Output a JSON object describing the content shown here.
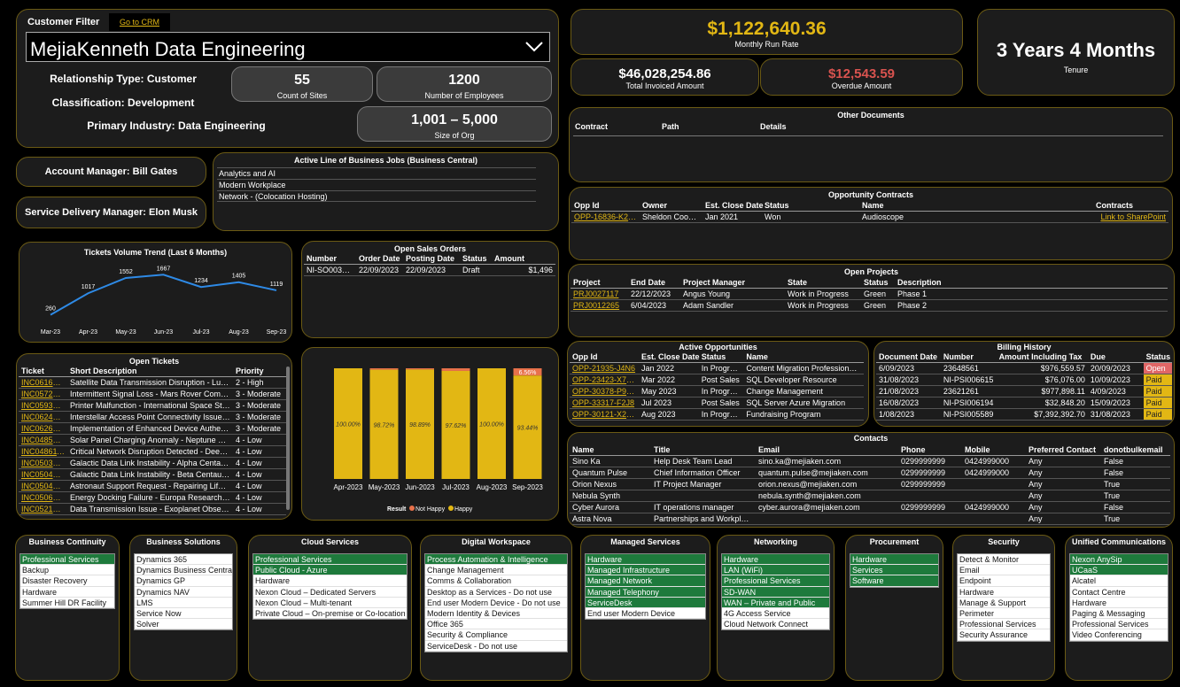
{
  "filter": {
    "label": "Customer Filter",
    "crm_link": "Go to CRM",
    "selected": "MejiaKenneth Data Engineering"
  },
  "customer": {
    "relationship": "Relationship Type: Customer",
    "classification": "Classification: Development",
    "industry": "Primary Industry: Data Engineering",
    "sites": {
      "value": "55",
      "caption": "Count of Sites"
    },
    "employees": {
      "value": "1200",
      "caption": "Number of Employees"
    },
    "org": {
      "value": "1,001 – 5,000",
      "caption": "Size of Org"
    }
  },
  "kpi": {
    "run_rate": {
      "value": "$1,122,640.36",
      "caption": "Monthly Run Rate"
    },
    "invoiced": {
      "value": "$46,028,254.86",
      "caption": "Total Invoiced Amount"
    },
    "overdue": {
      "value": "$12,543.59",
      "caption": "Overdue Amount"
    },
    "tenure": {
      "value": "3 Years 4 Months",
      "caption": "Tenure"
    }
  },
  "colors": {
    "gold": "#e2b714",
    "red": "#d9534f",
    "green": "#1e7a3c",
    "line": "#2e8ae6",
    "not_happy": "#e8714a"
  },
  "managers": {
    "account": "Account Manager: Bill Gates",
    "service": "Service Delivery Manager: Elon Musk"
  },
  "lob": {
    "title": "Active Line of Business Jobs (Business Central)",
    "items": [
      "Analytics and AI",
      "Modern Workplace",
      "Network - (Colocation Hosting)"
    ]
  },
  "docs": {
    "title": "Other Documents",
    "headers": [
      "Contract",
      "Path",
      "Details"
    ]
  },
  "opp_contracts": {
    "title": "Opportunity Contracts",
    "headers": [
      "Opp Id",
      "Owner",
      "Est. Close Date",
      "Status",
      "Name",
      "Contracts"
    ],
    "rows": [
      [
        "OPP-16836-K2X5",
        "Sheldon Cooper",
        "Jan 2021",
        "Won",
        "Audioscope",
        "Link to SharePoint"
      ]
    ]
  },
  "tickets_trend": {
    "title": "Tickets Volume Trend (Last 6 Months)"
  },
  "chart_data": [
    {
      "type": "line",
      "title": "Tickets Volume Trend (Last 6 Months)",
      "categories": [
        "Mar-23",
        "Apr-23",
        "May-23",
        "Jun-23",
        "Jul-23",
        "Aug-23",
        "Sep-23"
      ],
      "values": [
        260,
        1017,
        1552,
        1667,
        1234,
        1405,
        1119
      ],
      "labels": [
        "260",
        "1017",
        "1552",
        "1667",
        "1234",
        "1405",
        "1119"
      ]
    },
    {
      "type": "bar",
      "stacked": true,
      "categories": [
        "Apr-2023",
        "May-2023",
        "Jun-2023",
        "Jul-2023",
        "Aug-2023",
        "Sep-2023"
      ],
      "series": [
        {
          "name": "Happy",
          "values": [
            100.0,
            98.72,
            98.89,
            97.62,
            100.0,
            93.44
          ]
        },
        {
          "name": "Not Happy",
          "values": [
            0,
            1.28,
            1.11,
            2.38,
            0,
            6.56
          ]
        }
      ],
      "happy_labels": [
        "100.00%",
        "98.72%",
        "98.89%",
        "97.62%",
        "100.00%",
        "93.44%"
      ],
      "not_happy_label": "6.56%",
      "legend_title": "Result",
      "legend": [
        "Not Happy",
        "Happy"
      ]
    }
  ],
  "sales_orders": {
    "title": "Open Sales Orders",
    "headers": [
      "Number",
      "Order Date",
      "Posting Date",
      "Status",
      "Amount"
    ],
    "rows": [
      [
        "NI-SO003184",
        "22/09/2023",
        "22/09/2023",
        "Draft",
        "$1,496"
      ]
    ]
  },
  "projects": {
    "title": "Open Projects",
    "headers": [
      "Project",
      "End Date",
      "Project Manager",
      "State",
      "Status",
      "Description"
    ],
    "rows": [
      [
        "PRJ0027117",
        "22/12/2023",
        "Angus Young",
        "Work in Progress",
        "Green",
        "Phase 1"
      ],
      [
        "PRJ0012265",
        "6/04/2023",
        "Adam Sandler",
        "Work in Progress",
        "Green",
        "Phase 2"
      ]
    ]
  },
  "tickets": {
    "title": "Open Tickets",
    "headers": [
      "Ticket",
      "Short Description",
      "Priority"
    ],
    "rows": [
      [
        "INC0616232",
        "Satellite Data Transmission Disruption - Luna...",
        "2 - High"
      ],
      [
        "INC0572587",
        "Intermittent Signal Loss - Mars Rover Comm...",
        "3 - Moderate"
      ],
      [
        "INC0593758",
        "Printer Malfunction - International Space Sta...",
        "3 - Moderate"
      ],
      [
        "INC0624386",
        "Interstellar Access Point Connectivity Issue - ...",
        "3 - Moderate"
      ],
      [
        "INC0626735",
        "Implementation of Enhanced Device Authen...",
        "3 - Moderate"
      ],
      [
        "INC0485341",
        "Solar Panel Charging Anomaly - Neptune Re...",
        "4 - Low"
      ],
      [
        "INC0486118",
        "Critical Network Disruption Detected - Deep ...",
        "4 - Low"
      ],
      [
        "INC0503784",
        "Galactic Data Link Instability - Alpha Centaur...",
        "4 - Low"
      ],
      [
        "INC0504832",
        "Galactic Data Link Instability - Beta Centauri ...",
        "4 - Low"
      ],
      [
        "INC0504833",
        "Astronaut Support Request - Repairing Life S...",
        "4 - Low"
      ],
      [
        "INC0506844",
        "Energy Docking Failure - Europa Research Fa...",
        "4 - Low"
      ],
      [
        "INC0521245",
        "Data Transmission Issue - Exoplanet Observa...",
        "4 - Low"
      ]
    ]
  },
  "active_opps": {
    "title": "Active Opportunities",
    "headers": [
      "Opp Id",
      "Est. Close Date",
      "Status",
      "Name"
    ],
    "rows": [
      [
        "OPP-21935-J4N6",
        "Jan 2022",
        "In Progress",
        "Content Migration Professional..."
      ],
      [
        "OPP-23423-X7W8",
        "Mar 2022",
        "Post Sales",
        "SQL Developer Resource"
      ],
      [
        "OPP-30378-P9R3",
        "May 2023",
        "In Progress",
        "Change Management"
      ],
      [
        "OPP-33317-F2J8",
        "Jul 2023",
        "Post Sales",
        "SQL Server Azure Migration"
      ],
      [
        "OPP-30121-X2P5",
        "Aug 2023",
        "In Progress",
        "Fundraising Program"
      ]
    ]
  },
  "billing": {
    "title": "Billing History",
    "headers": [
      "Document Date",
      "Number",
      "Amount Including Tax",
      "Due",
      "Status"
    ],
    "rows": [
      [
        "6/09/2023",
        "23648561",
        "$976,559.57",
        "20/09/2023",
        "Open"
      ],
      [
        "31/08/2023",
        "NI-PSI006615",
        "$76,076.00",
        "10/09/2023",
        "Paid"
      ],
      [
        "21/08/2023",
        "23621261",
        "$977,898.11",
        "4/09/2023",
        "Paid"
      ],
      [
        "16/08/2023",
        "NI-PSI006194",
        "$32,848.20",
        "15/09/2023",
        "Paid"
      ],
      [
        "1/08/2023",
        "NI-PSI005589",
        "$7,392,392.70",
        "31/08/2023",
        "Paid"
      ]
    ]
  },
  "contacts": {
    "title": "Contacts",
    "headers": [
      "Name",
      "Title",
      "Email",
      "Phone",
      "Mobile",
      "Preferred Contact",
      "donotbulkemail"
    ],
    "rows": [
      [
        "Sino Ka",
        "Help Desk Team Lead",
        "sino.ka@mejiaken.com",
        "0299999999",
        "0424999000",
        "Any",
        "False"
      ],
      [
        "Quantum Pulse",
        "Chief Information Officer",
        "quantum.pulse@mejiaken.com",
        "0299999999",
        "0424999000",
        "Any",
        "False"
      ],
      [
        "Orion Nexus",
        "IT Project Manager",
        "orion.nexus@mejiaken.com",
        "0299999999",
        "",
        "Any",
        "True"
      ],
      [
        "Nebula Synth",
        "",
        "nebula.synth@mejiaken.com",
        "",
        "",
        "Any",
        "True"
      ],
      [
        "Cyber Aurora",
        "IT operations manager",
        "cyber.aurora@mejiaken.com",
        "0299999999",
        "0424999000",
        "Any",
        "False"
      ],
      [
        "Astra Nova",
        "Partnerships and Workplac...",
        "",
        "",
        "",
        "Any",
        "True"
      ]
    ]
  },
  "services": [
    {
      "title": "Business Continuity",
      "items": [
        "Professional Services",
        "Backup",
        "Disaster Recovery",
        "Hardware",
        "Summer Hill DR Facility"
      ],
      "sel": [
        0
      ]
    },
    {
      "title": "Business Solutions",
      "items": [
        "Dynamics 365",
        "Dynamics Business Central",
        "Dynamics GP",
        "Dynamics NAV",
        "LMS",
        "Service Now",
        "Solver"
      ],
      "sel": []
    },
    {
      "title": "Cloud Services",
      "items": [
        "Professional Services",
        "Public Cloud - Azure",
        "Hardware",
        "Nexon Cloud – Dedicated Servers",
        "Nexon Cloud – Multi-tenant",
        "Private Cloud – On-premise or Co-location"
      ],
      "sel": [
        0,
        1
      ]
    },
    {
      "title": "Digital Workspace",
      "items": [
        "Process Automation & Intelligence",
        "Change Management",
        "Comms & Collaboration",
        "Desktop as a Services - Do not use",
        "End user Modern Device - Do not use",
        "Modern Identity & Devices",
        "Office 365",
        "Security & Compliance",
        "ServiceDesk - Do not use"
      ],
      "sel": [
        0
      ]
    },
    {
      "title": "Managed Services",
      "items": [
        "Hardware",
        "Managed Infrastructure",
        "Managed Network",
        "Managed Telephony",
        "ServiceDesk",
        "End user Modern Device"
      ],
      "sel": [
        0,
        1,
        2,
        3,
        4
      ]
    },
    {
      "title": "Networking",
      "items": [
        "Hardware",
        "LAN (WiFi)",
        "Professional Services",
        "SD-WAN",
        "WAN – Private and Public",
        "4G Access Service",
        "Cloud Network Connect"
      ],
      "sel": [
        0,
        1,
        2,
        3,
        4
      ]
    },
    {
      "title": "Procurement",
      "items": [
        "Hardware",
        "Services",
        "Software"
      ],
      "sel": [
        0,
        1,
        2
      ]
    },
    {
      "title": "Security",
      "items": [
        "Detect & Monitor",
        "Email",
        "Endpoint",
        "Hardware",
        "Manage & Support",
        "Perimeter",
        "Professional Services",
        "Security Assurance"
      ],
      "sel": []
    },
    {
      "title": "Unified Communications",
      "items": [
        "Nexon AnySip",
        "UCaaS",
        "Alcatel",
        "Contact Centre",
        "Hardware",
        "Paging & Messaging",
        "Professional Services",
        "Video Conferencing"
      ],
      "sel": [
        0,
        1
      ]
    }
  ]
}
